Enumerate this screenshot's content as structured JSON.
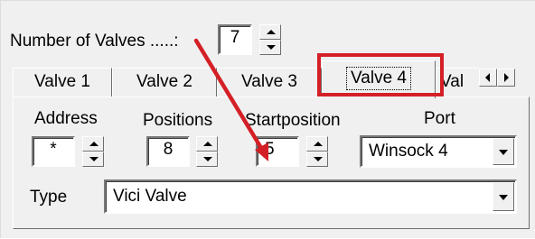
{
  "number_of_valves": {
    "label": "Number of Valves .....:",
    "value": "7"
  },
  "tabs": [
    {
      "label": "Valve 1",
      "selected": false
    },
    {
      "label": "Valve 2",
      "selected": false
    },
    {
      "label": "Valve 3",
      "selected": false
    },
    {
      "label": "Valve 4",
      "selected": true
    },
    {
      "label": "Val",
      "selected": false
    }
  ],
  "panel": {
    "address": {
      "label": "Address",
      "value": "*"
    },
    "positions": {
      "label": "Positions",
      "value": "8"
    },
    "startposition": {
      "label": "Startposition",
      "value": "5"
    },
    "port": {
      "label": "Port",
      "value": "Winsock 4"
    },
    "type": {
      "label": "Type",
      "value": "Vici Valve"
    }
  },
  "annotation": {
    "highlight_color": "#d41f26",
    "arrow_color": "#d41f26"
  },
  "icons": [
    "spin-up-icon",
    "spin-down-icon",
    "dropdown-arrow-icon",
    "tab-scroll-left-icon",
    "tab-scroll-right-icon",
    "annotation-arrow"
  ]
}
